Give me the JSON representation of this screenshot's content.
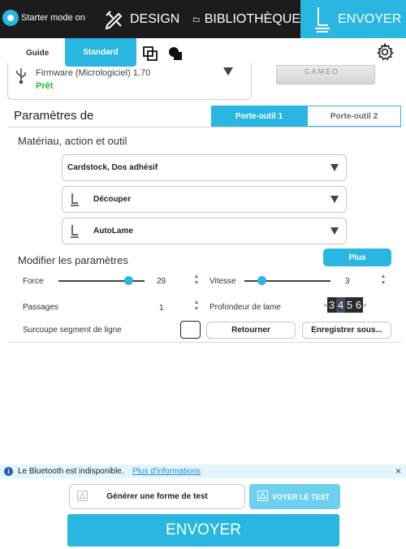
{
  "topbar": {
    "starter_mode_label": "Starter mode on",
    "starter_mode_on": true,
    "tabs": [
      {
        "label": "DESIGN",
        "icon": "design-pencil-ruler-icon"
      },
      {
        "label": "BIBLIOTHÈQUE",
        "icon": "folder-icon"
      },
      {
        "label": "ENVOYER",
        "icon": "blade-send-icon",
        "active": true
      }
    ]
  },
  "subtabs": {
    "guide_label": "Guide",
    "standard_label": "Standard",
    "icons": [
      "layers-outline-icon",
      "fill-shapes-icon",
      "gear-icon"
    ]
  },
  "machine": {
    "firmware_label": "Firmware (Micrologiciel) 1.70",
    "status": "Prêt",
    "brand": "CAMEO",
    "connection_icon": "usb-icon"
  },
  "parameters": {
    "title": "Paramètres de",
    "tool_tabs": [
      "Porte-outil 1",
      "Porte-outil 2"
    ],
    "material_section_title": "Matériau, action et outil",
    "material": "Cardstock, Dos adhésif",
    "action": "Découper",
    "tool": "AutoLame",
    "modify_section_title": "Modifier les paramètres",
    "more_label": "Plus",
    "force_label": "Force",
    "force_value": "29",
    "force_fraction": 0.82,
    "speed_label": "Vitesse",
    "speed_value": "3",
    "speed_fraction": 0.2,
    "passes_label": "Passages",
    "passes_value": "1",
    "blade_depth_label": "Profondeur de lame",
    "blade_depth_digits": [
      "3",
      "4",
      "5",
      "6"
    ],
    "blade_depth_selected": "4",
    "overcut_label": "Surcoupe segment de ligne",
    "overcut_checked": false,
    "return_label": "Retourner",
    "save_as_label": "Enregistrer sous..."
  },
  "bluetooth": {
    "message": "Le Bluetooth est indisponible.",
    "link": "Plus d'informations",
    "close": "×",
    "info_glyph": "i"
  },
  "footer": {
    "test_shape_label": "Générer une forme de test",
    "send_test_label": "VOYER LE TEST",
    "send_label": "ENVOYER"
  },
  "colors": {
    "accent": "#29b6e0",
    "topbar": "#1c1c1c",
    "ready": "#1fbf2a",
    "link": "#1a8fd1"
  }
}
